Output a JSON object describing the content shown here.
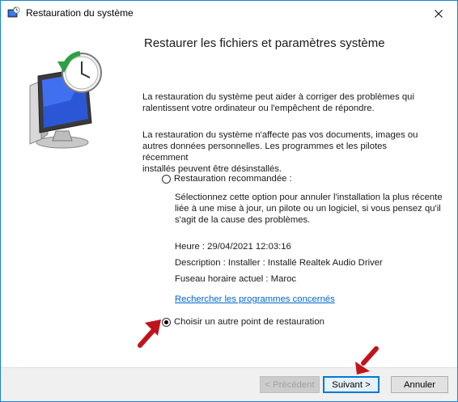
{
  "window": {
    "title": "Restauration du système",
    "icon": "system-restore-icon",
    "close_icon": "close-icon"
  },
  "main": {
    "heading": "Restaurer les fichiers et paramètres système",
    "para1_line1": "La restauration du système peut aider à corriger des problèmes qui",
    "para1_line2": "ralentissent votre ordinateur ou l'empêchent de répondre.",
    "para2_line1": "La restauration du système n'affecte pas vos documents, images ou",
    "para2_line2": "autres données personnelles. Les programmes et les pilotes récemment",
    "para2_line3": "installés peuvent être désinstallés."
  },
  "options": {
    "recommended": {
      "label": "Restauration recommandée :",
      "checked": false,
      "desc_line1": "Sélectionnez cette option pour annuler l'installation la plus récente",
      "desc_line2": "liée à une mise à jour, un pilote ou un logiciel, si vous pensez qu'il",
      "desc_line3": "s'agit de la cause des problèmes.",
      "time": "Heure : 29/04/2021 12:03:16",
      "description": "Description : Installer : Installé Realtek Audio Driver",
      "timezone": "Fuseau horaire actuel : Maroc",
      "link": "Rechercher les programmes concernés"
    },
    "other": {
      "label": "Choisir un autre point de restauration",
      "checked": true
    }
  },
  "buttons": {
    "previous": "< Précédent",
    "next": "Suivant >",
    "cancel": "Annuler"
  },
  "colors": {
    "accent": "#0078d7",
    "link": "#0066cc",
    "annotation_arrow": "#c0141c"
  }
}
